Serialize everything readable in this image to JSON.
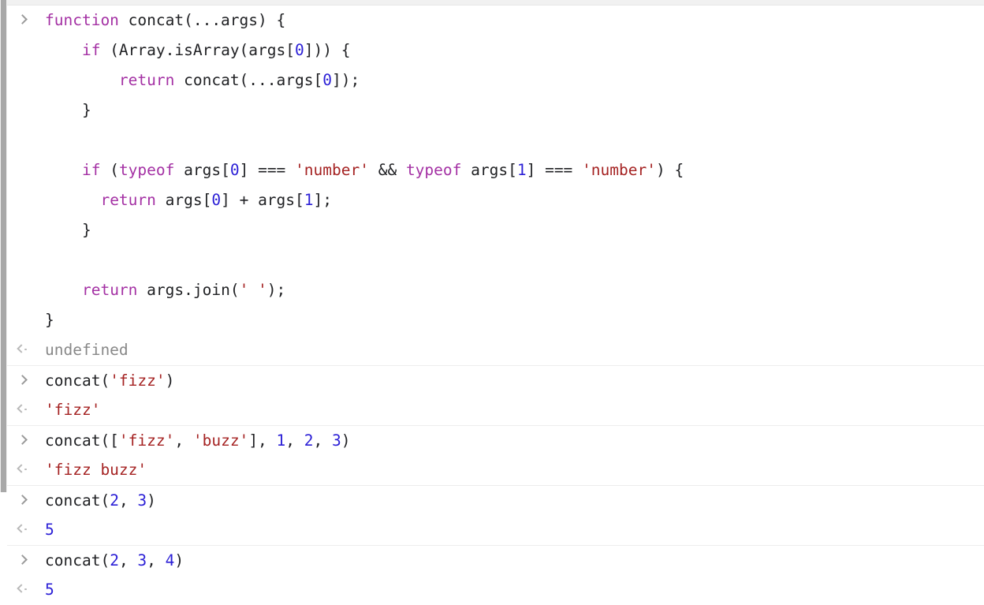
{
  "app": {
    "name": "devtools-console",
    "title": "Console"
  },
  "colors": {
    "background": "#ffffff",
    "keyword": "#a431a4",
    "string": "#a52323",
    "number": "#2b1fd6",
    "plain": "#202124",
    "undefined": "#888888",
    "divider": "#ededed",
    "rail": "#a8a8a8"
  },
  "icons": {
    "input": "chevron-right-icon",
    "output": "chevron-left-dot-icon"
  },
  "entries": [
    {
      "type": "input",
      "icon": "chevron-right-icon",
      "lines": [
        [
          {
            "t": "function",
            "c": "kw"
          },
          {
            "t": " concat(...args) {",
            "c": "plain"
          }
        ],
        [
          {
            "t": "    ",
            "c": "plain"
          },
          {
            "t": "if",
            "c": "kw"
          },
          {
            "t": " (Array.isArray(args[",
            "c": "plain"
          },
          {
            "t": "0",
            "c": "num"
          },
          {
            "t": "])) {",
            "c": "plain"
          }
        ],
        [
          {
            "t": "        ",
            "c": "plain"
          },
          {
            "t": "return",
            "c": "kw"
          },
          {
            "t": " concat(...args[",
            "c": "plain"
          },
          {
            "t": "0",
            "c": "num"
          },
          {
            "t": "]);",
            "c": "plain"
          }
        ],
        [
          {
            "t": "    }",
            "c": "plain"
          }
        ],
        [
          {
            "t": "",
            "c": "plain"
          }
        ],
        [
          {
            "t": "    ",
            "c": "plain"
          },
          {
            "t": "if",
            "c": "kw"
          },
          {
            "t": " (",
            "c": "plain"
          },
          {
            "t": "typeof",
            "c": "kw"
          },
          {
            "t": " args[",
            "c": "plain"
          },
          {
            "t": "0",
            "c": "num"
          },
          {
            "t": "] === ",
            "c": "plain"
          },
          {
            "t": "'number'",
            "c": "str"
          },
          {
            "t": " && ",
            "c": "plain"
          },
          {
            "t": "typeof",
            "c": "kw"
          },
          {
            "t": " args[",
            "c": "plain"
          },
          {
            "t": "1",
            "c": "num"
          },
          {
            "t": "] === ",
            "c": "plain"
          },
          {
            "t": "'number'",
            "c": "str"
          },
          {
            "t": ") {",
            "c": "plain"
          }
        ],
        [
          {
            "t": "      ",
            "c": "plain"
          },
          {
            "t": "return",
            "c": "kw"
          },
          {
            "t": " args[",
            "c": "plain"
          },
          {
            "t": "0",
            "c": "num"
          },
          {
            "t": "] + args[",
            "c": "plain"
          },
          {
            "t": "1",
            "c": "num"
          },
          {
            "t": "];",
            "c": "plain"
          }
        ],
        [
          {
            "t": "    }",
            "c": "plain"
          }
        ],
        [
          {
            "t": "",
            "c": "plain"
          }
        ],
        [
          {
            "t": "    ",
            "c": "plain"
          },
          {
            "t": "return",
            "c": "kw"
          },
          {
            "t": " args.join(",
            "c": "plain"
          },
          {
            "t": "' '",
            "c": "str"
          },
          {
            "t": ");",
            "c": "plain"
          }
        ],
        [
          {
            "t": "}",
            "c": "plain"
          }
        ]
      ]
    },
    {
      "type": "output",
      "icon": "chevron-left-dot-icon",
      "lines": [
        [
          {
            "t": "undefined",
            "c": "undef"
          }
        ]
      ]
    },
    {
      "type": "input",
      "icon": "chevron-right-icon",
      "divider": true,
      "lines": [
        [
          {
            "t": "concat(",
            "c": "plain"
          },
          {
            "t": "'fizz'",
            "c": "str"
          },
          {
            "t": ")",
            "c": "plain"
          }
        ]
      ]
    },
    {
      "type": "output",
      "icon": "chevron-left-dot-icon",
      "lines": [
        [
          {
            "t": "'fizz'",
            "c": "str"
          }
        ]
      ]
    },
    {
      "type": "input",
      "icon": "chevron-right-icon",
      "divider": true,
      "lines": [
        [
          {
            "t": "concat([",
            "c": "plain"
          },
          {
            "t": "'fizz'",
            "c": "str"
          },
          {
            "t": ", ",
            "c": "plain"
          },
          {
            "t": "'buzz'",
            "c": "str"
          },
          {
            "t": "], ",
            "c": "plain"
          },
          {
            "t": "1",
            "c": "num"
          },
          {
            "t": ", ",
            "c": "plain"
          },
          {
            "t": "2",
            "c": "num"
          },
          {
            "t": ", ",
            "c": "plain"
          },
          {
            "t": "3",
            "c": "num"
          },
          {
            "t": ")",
            "c": "plain"
          }
        ]
      ]
    },
    {
      "type": "output",
      "icon": "chevron-left-dot-icon",
      "lines": [
        [
          {
            "t": "'fizz buzz'",
            "c": "str"
          }
        ]
      ]
    },
    {
      "type": "input",
      "icon": "chevron-right-icon",
      "divider": true,
      "lines": [
        [
          {
            "t": "concat(",
            "c": "plain"
          },
          {
            "t": "2",
            "c": "num"
          },
          {
            "t": ", ",
            "c": "plain"
          },
          {
            "t": "3",
            "c": "num"
          },
          {
            "t": ")",
            "c": "plain"
          }
        ]
      ]
    },
    {
      "type": "output",
      "icon": "chevron-left-dot-icon",
      "lines": [
        [
          {
            "t": "5",
            "c": "num"
          }
        ]
      ]
    },
    {
      "type": "input",
      "icon": "chevron-right-icon",
      "divider": true,
      "lines": [
        [
          {
            "t": "concat(",
            "c": "plain"
          },
          {
            "t": "2",
            "c": "num"
          },
          {
            "t": ", ",
            "c": "plain"
          },
          {
            "t": "3",
            "c": "num"
          },
          {
            "t": ", ",
            "c": "plain"
          },
          {
            "t": "4",
            "c": "num"
          },
          {
            "t": ")",
            "c": "plain"
          }
        ]
      ]
    },
    {
      "type": "output",
      "icon": "chevron-left-dot-icon",
      "lines": [
        [
          {
            "t": "5",
            "c": "num"
          }
        ]
      ]
    }
  ]
}
